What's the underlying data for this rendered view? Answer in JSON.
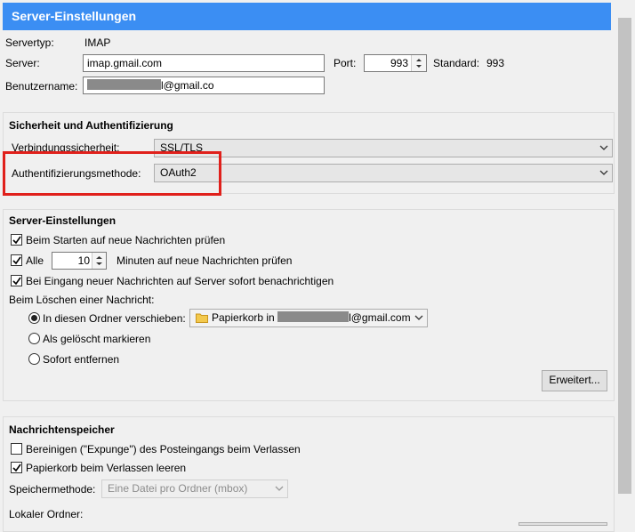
{
  "title": "Server-Einstellungen",
  "server": {
    "type_label": "Servertyp:",
    "type_value": "IMAP",
    "server_label": "Server:",
    "server_value": "imap.gmail.com",
    "port_label": "Port:",
    "port_value": "993",
    "standard_label": "Standard:",
    "standard_value": "993",
    "username_label": "Benutzername:",
    "username_suffix": "l@gmail.co"
  },
  "security": {
    "title": "Sicherheit und Authentifizierung",
    "connection_label": "Verbindungssicherheit:",
    "connection_value": "SSL/TLS",
    "auth_label": "Authentifizierungsmethode:",
    "auth_value": "OAuth2"
  },
  "settings": {
    "title": "Server-Einstellungen",
    "check_startup": "Beim Starten auf neue Nachrichten prüfen",
    "check_every": "Alle",
    "minutes_value": "10",
    "minutes_label": "Minuten auf neue Nachrichten prüfen",
    "notify_label": "Bei Eingang neuer Nachrichten auf Server sofort benachrichtigen",
    "delete_label": "Beim Löschen einer Nachricht:",
    "move_label": "In diesen Ordner verschieben:",
    "folder_prefix": "Papierkorb in",
    "folder_suffix": "l@gmail.com",
    "mark_deleted": "Als gelöscht markieren",
    "remove_now": "Sofort entfernen",
    "advanced_button": "Erweitert..."
  },
  "storage": {
    "title": "Nachrichtenspeicher",
    "expunge_label": "Bereinigen (\"Expunge\") des Posteingangs beim Verlassen",
    "empty_trash": "Papierkorb beim Verlassen leeren",
    "method_label": "Speichermethode:",
    "method_value": "Eine Datei pro Ordner (mbox)",
    "local_folder": "Lokaler Ordner:"
  }
}
